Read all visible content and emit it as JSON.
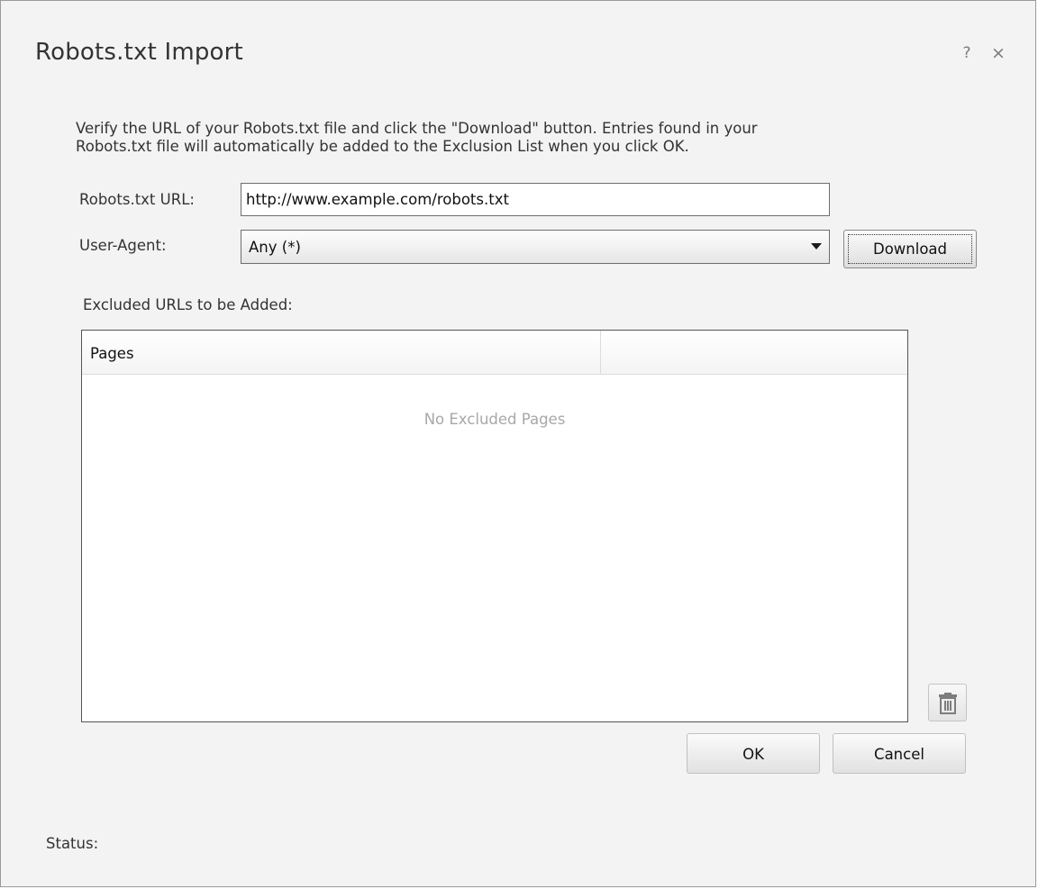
{
  "dialog": {
    "title": "Robots.txt Import",
    "help_glyph": "?",
    "close_glyph": "×"
  },
  "instructions": {
    "line1": "Verify the URL of your Robots.txt file and click the \"Download\" button. Entries found in your",
    "line2": "Robots.txt file will automatically be added to the Exclusion List when you click OK."
  },
  "form": {
    "url_label": "Robots.txt URL:",
    "url_value": "http://www.example.com/robots.txt",
    "user_agent_label": "User-Agent:",
    "user_agent_selected": "Any (*)",
    "download_label": "Download"
  },
  "excluded": {
    "section_label": "Excluded URLs to be Added:",
    "columns": [
      "Pages",
      ""
    ],
    "empty_message": "No Excluded Pages"
  },
  "actions": {
    "ok_label": "OK",
    "cancel_label": "Cancel"
  },
  "status": {
    "label": "Status:"
  },
  "icons": {
    "help": "help-icon",
    "close": "close-icon",
    "dropdown": "chevron-down-icon",
    "delete": "trash-icon"
  }
}
